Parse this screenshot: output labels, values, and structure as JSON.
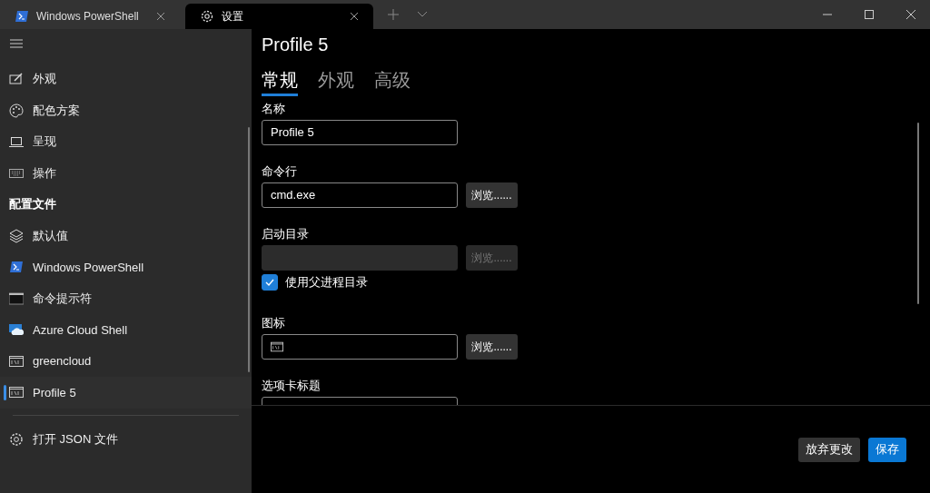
{
  "tabs": [
    {
      "title": "Windows PowerShell",
      "selected": false
    },
    {
      "title": "设置",
      "selected": true
    }
  ],
  "sidebar": {
    "items": [
      {
        "kind": "item",
        "label": "外观",
        "selected": false
      },
      {
        "kind": "item",
        "label": "配色方案",
        "selected": false
      },
      {
        "kind": "item",
        "label": "呈现",
        "selected": false
      },
      {
        "kind": "item",
        "label": "操作",
        "selected": false
      },
      {
        "kind": "header",
        "label": "配置文件"
      },
      {
        "kind": "item",
        "label": "默认值",
        "selected": false
      },
      {
        "kind": "item",
        "label": "Windows PowerShell",
        "selected": false
      },
      {
        "kind": "item",
        "label": "命令提示符",
        "selected": false
      },
      {
        "kind": "item",
        "label": "Azure Cloud Shell",
        "selected": false
      },
      {
        "kind": "item",
        "label": "greencloud",
        "selected": false
      },
      {
        "kind": "item",
        "label": "Profile 5",
        "selected": true
      }
    ],
    "footer_item": {
      "label": "打开 JSON 文件"
    }
  },
  "page": {
    "title": "Profile 5",
    "tabs": [
      {
        "label": "常规",
        "selected": true
      },
      {
        "label": "外观",
        "selected": false
      },
      {
        "label": "高级",
        "selected": false
      }
    ],
    "fields": [
      {
        "kind": "text",
        "label": "名称",
        "value": "Profile 5",
        "disabled": false
      },
      {
        "kind": "text",
        "label": "命令行",
        "value": "cmd.exe",
        "browse": "浏览......",
        "disabled": false
      },
      {
        "kind": "text",
        "label": "启动目录",
        "browse": "浏览......",
        "disabled": true
      },
      {
        "kind": "checkbox",
        "label": "使用父进程目录",
        "checked": true
      },
      {
        "kind": "icon",
        "label": "图标",
        "browse": "浏览......"
      },
      {
        "kind": "text",
        "label": "选项卡标题",
        "disabled": false
      }
    ]
  },
  "buttons": [
    {
      "label": "放弃更改",
      "kind": "secondary"
    },
    {
      "label": "保存",
      "kind": "primary"
    }
  ]
}
